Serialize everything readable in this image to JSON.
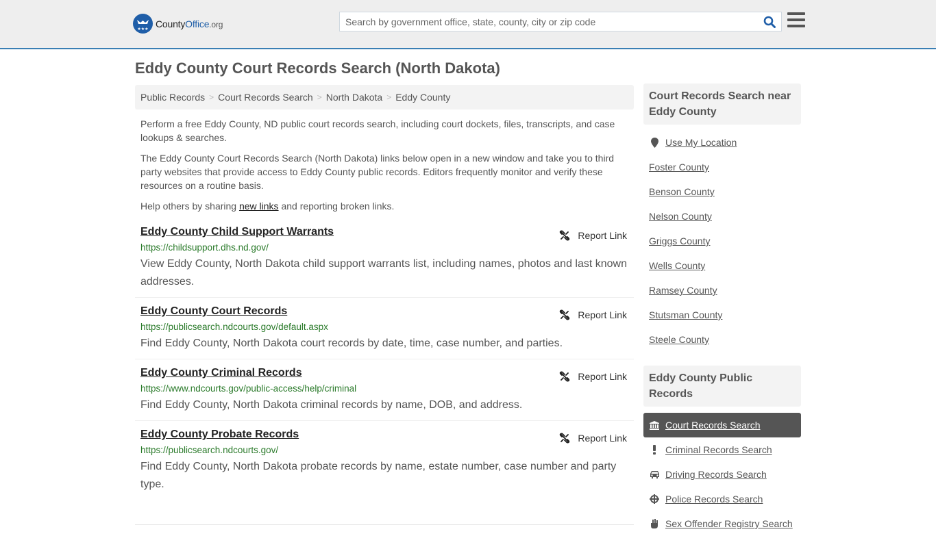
{
  "header": {
    "logo": {
      "name_part1": "County",
      "name_part2": "Office",
      "name_part3": ".org"
    },
    "search": {
      "placeholder": "Search by government office, state, county, city or zip code",
      "value": ""
    },
    "brand_color": "#1f5ea8",
    "accent_border_color": "#3a7fb4"
  },
  "page": {
    "title": "Eddy County Court Records Search (North Dakota)"
  },
  "breadcrumb": [
    {
      "label": "Public Records"
    },
    {
      "label": "Court Records Search"
    },
    {
      "label": "North Dakota"
    },
    {
      "label": "Eddy County"
    }
  ],
  "intro": {
    "p1": "Perform a free Eddy County, ND public court records search, including court dockets, files, transcripts, and case lookups & searches.",
    "p2": "The Eddy County Court Records Search (North Dakota) links below open in a new window and take you to third party websites that provide access to Eddy County public records. Editors frequently monitor and verify these resources on a routine basis.",
    "p3_before": "Help others by sharing ",
    "p3_link": "new links",
    "p3_after": " and reporting broken links."
  },
  "report_label": "Report Link",
  "links": [
    {
      "title": "Eddy County Child Support Warrants",
      "url": "https://childsupport.dhs.nd.gov/",
      "description": "View Eddy County, North Dakota child support warrants list, including names, photos and last known addresses."
    },
    {
      "title": "Eddy County Court Records",
      "url": "https://publicsearch.ndcourts.gov/default.aspx",
      "description": "Find Eddy County, North Dakota court records by date, time, case number, and parties."
    },
    {
      "title": "Eddy County Criminal Records",
      "url": "https://www.ndcourts.gov/public-access/help/criminal",
      "description": "Find Eddy County, North Dakota criminal records by name, DOB, and address."
    },
    {
      "title": "Eddy County Probate Records",
      "url": "https://publicsearch.ndcourts.gov/",
      "description": "Find Eddy County, North Dakota probate records by name, estate number, case number and party type."
    }
  ],
  "sidebar": {
    "near_heading": "Court Records Search near Eddy County",
    "use_location": "Use My Location",
    "nearby": [
      "Foster County",
      "Benson County",
      "Nelson County",
      "Griggs County",
      "Wells County",
      "Ramsey County",
      "Stutsman County",
      "Steele County"
    ],
    "public_heading": "Eddy County Public Records",
    "public_records": [
      {
        "label": "Court Records Search",
        "icon": "courthouse-icon",
        "active": true
      },
      {
        "label": "Criminal Records Search",
        "icon": "exclamation-icon",
        "active": false
      },
      {
        "label": "Driving Records Search",
        "icon": "car-icon",
        "active": false
      },
      {
        "label": "Police Records Search",
        "icon": "crosshair-icon",
        "active": false
      },
      {
        "label": "Sex Offender Registry Search",
        "icon": "hand-icon",
        "active": false
      }
    ]
  }
}
